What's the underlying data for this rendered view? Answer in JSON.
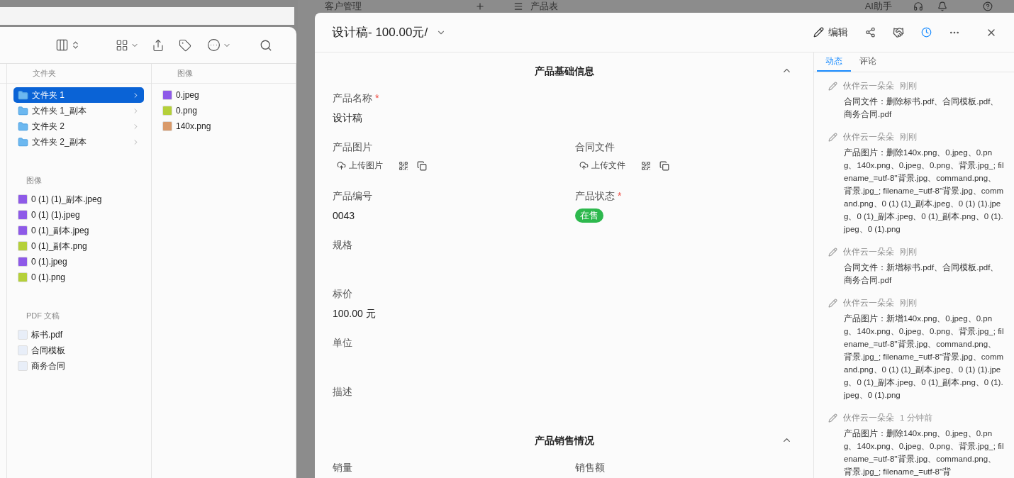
{
  "background_app": {
    "title": "客户管理",
    "table": "产品表",
    "assistant": "AI助手"
  },
  "finder": {
    "column_headers": [
      "文件夹",
      "图像"
    ],
    "folders": [
      {
        "name": "文件夹 1",
        "selected": true
      },
      {
        "name": "文件夹 1_副本",
        "selected": false
      },
      {
        "name": "文件夹 2",
        "selected": false
      },
      {
        "name": "文件夹 2_副本",
        "selected": false
      }
    ],
    "groups": [
      {
        "heading": "图像",
        "items": [
          {
            "name": "0 (1) (1)_副本.jpeg",
            "kind": "jpeg"
          },
          {
            "name": "0 (1) (1).jpeg",
            "kind": "jpeg"
          },
          {
            "name": "0 (1)_副本.jpeg",
            "kind": "jpeg"
          },
          {
            "name": "0 (1)_副本.png",
            "kind": "png"
          },
          {
            "name": "0 (1).jpeg",
            "kind": "jpeg"
          },
          {
            "name": "0 (1).png",
            "kind": "png"
          }
        ]
      },
      {
        "heading": "PDF 文稿",
        "items": [
          {
            "name": "标书.pdf",
            "kind": "pdf"
          },
          {
            "name": "合同模板",
            "kind": "pdf"
          },
          {
            "name": "商务合同",
            "kind": "pdf"
          }
        ]
      }
    ],
    "preview_items": [
      {
        "name": "0.jpeg",
        "kind": "jpeg"
      },
      {
        "name": "0.png",
        "kind": "png"
      },
      {
        "name": "140x.png",
        "kind": "photo"
      }
    ]
  },
  "record": {
    "title": "设计稿- 100.00元/",
    "edit_label": "编辑",
    "sections": [
      {
        "title": "产品基础信息",
        "fields": [
          {
            "label": "产品名称",
            "required_mark": "*",
            "wide": true,
            "kind": "text",
            "value": "设计稿"
          },
          {
            "label": "产品图片",
            "wide": false,
            "kind": "upload",
            "value": "上传图片"
          },
          {
            "label": "合同文件",
            "wide": false,
            "kind": "upload",
            "value": "上传文件"
          },
          {
            "label": "产品编号",
            "wide": false,
            "kind": "text",
            "value": "0043"
          },
          {
            "label": "产品状态",
            "required_mark": "*",
            "wide": false,
            "kind": "status",
            "value": "在售"
          },
          {
            "label": "规格",
            "wide": true,
            "kind": "text"
          },
          {
            "label": "标价",
            "wide": true,
            "kind": "text",
            "value": "100.00 元"
          },
          {
            "label": "单位",
            "wide": true,
            "kind": "text"
          },
          {
            "label": "描述",
            "wide": true,
            "kind": "text"
          }
        ]
      },
      {
        "title": "产品销售情况",
        "fields": [
          {
            "label": "销量",
            "wide": false,
            "kind": "text"
          },
          {
            "label": "销售额",
            "wide": false,
            "kind": "text"
          }
        ]
      }
    ]
  },
  "activity_tabs": [
    {
      "label": "动态",
      "selected": true
    },
    {
      "label": "评论",
      "selected": false
    }
  ],
  "activity": [
    {
      "author": "伙伴云一朵朵",
      "time": "刚刚",
      "text": "合同文件：删除标书.pdf、合同模板.pdf、商务合同.pdf"
    },
    {
      "author": "伙伴云一朵朵",
      "time": "刚刚",
      "text": "产品图片：删除140x.png、0.jpeg、0.png、140x.png、0.jpeg、0.png、背景.jpg_; filename_=utf-8''背景.jpg、command.png、背景.jpg_; filename_=utf-8''背景.jpg、command.png、0 (1) (1)_副本.jpeg、0 (1) (1).jpeg、0 (1)_副本.jpeg、0 (1)_副本.png、0 (1).jpeg、0 (1).png"
    },
    {
      "author": "伙伴云一朵朵",
      "time": "刚刚",
      "text": "合同文件：新增标书.pdf、合同模板.pdf、商务合同.pdf"
    },
    {
      "author": "伙伴云一朵朵",
      "time": "刚刚",
      "text": "产品图片：新增140x.png、0.jpeg、0.png、140x.png、0.jpeg、0.png、背景.jpg_; filename_=utf-8''背景.jpg、command.png、背景.jpg_; filename_=utf-8''背景.jpg、command.png、0 (1) (1)_副本.jpeg、0 (1) (1).jpeg、0 (1)_副本.jpeg、0 (1)_副本.png、0 (1).jpeg、0 (1).png"
    },
    {
      "author": "伙伴云一朵朵",
      "time": "1 分钟前",
      "text": "产品图片：删除140x.png、0.jpeg、0.png、140x.png、0.jpeg、0.png、背景.jpg_; filename_=utf-8''背景.jpg、command.png、背景.jpg_; filename_=utf-8''背"
    }
  ]
}
